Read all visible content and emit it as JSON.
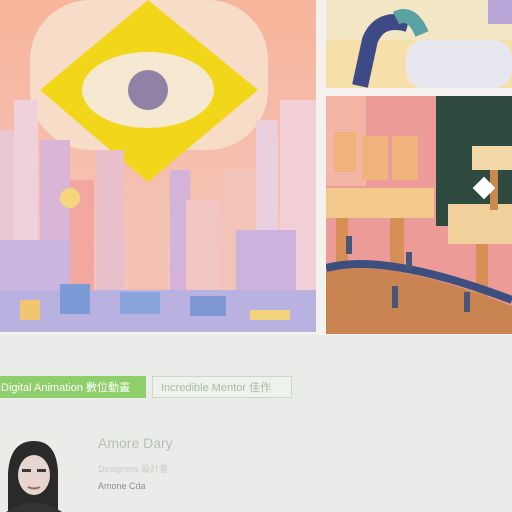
{
  "tags": {
    "primary": "Digital Animation 數位動畫",
    "secondary": "Incredible Mentor 佳作"
  },
  "designer": {
    "name": "Amore Dary",
    "role": "Designers 設計者",
    "sub": "Amone Cda"
  },
  "colors": {
    "tag_green": "#8fcf6b",
    "eye_yellow": "#f2d619",
    "sky_pink": "#f3b6a4"
  }
}
